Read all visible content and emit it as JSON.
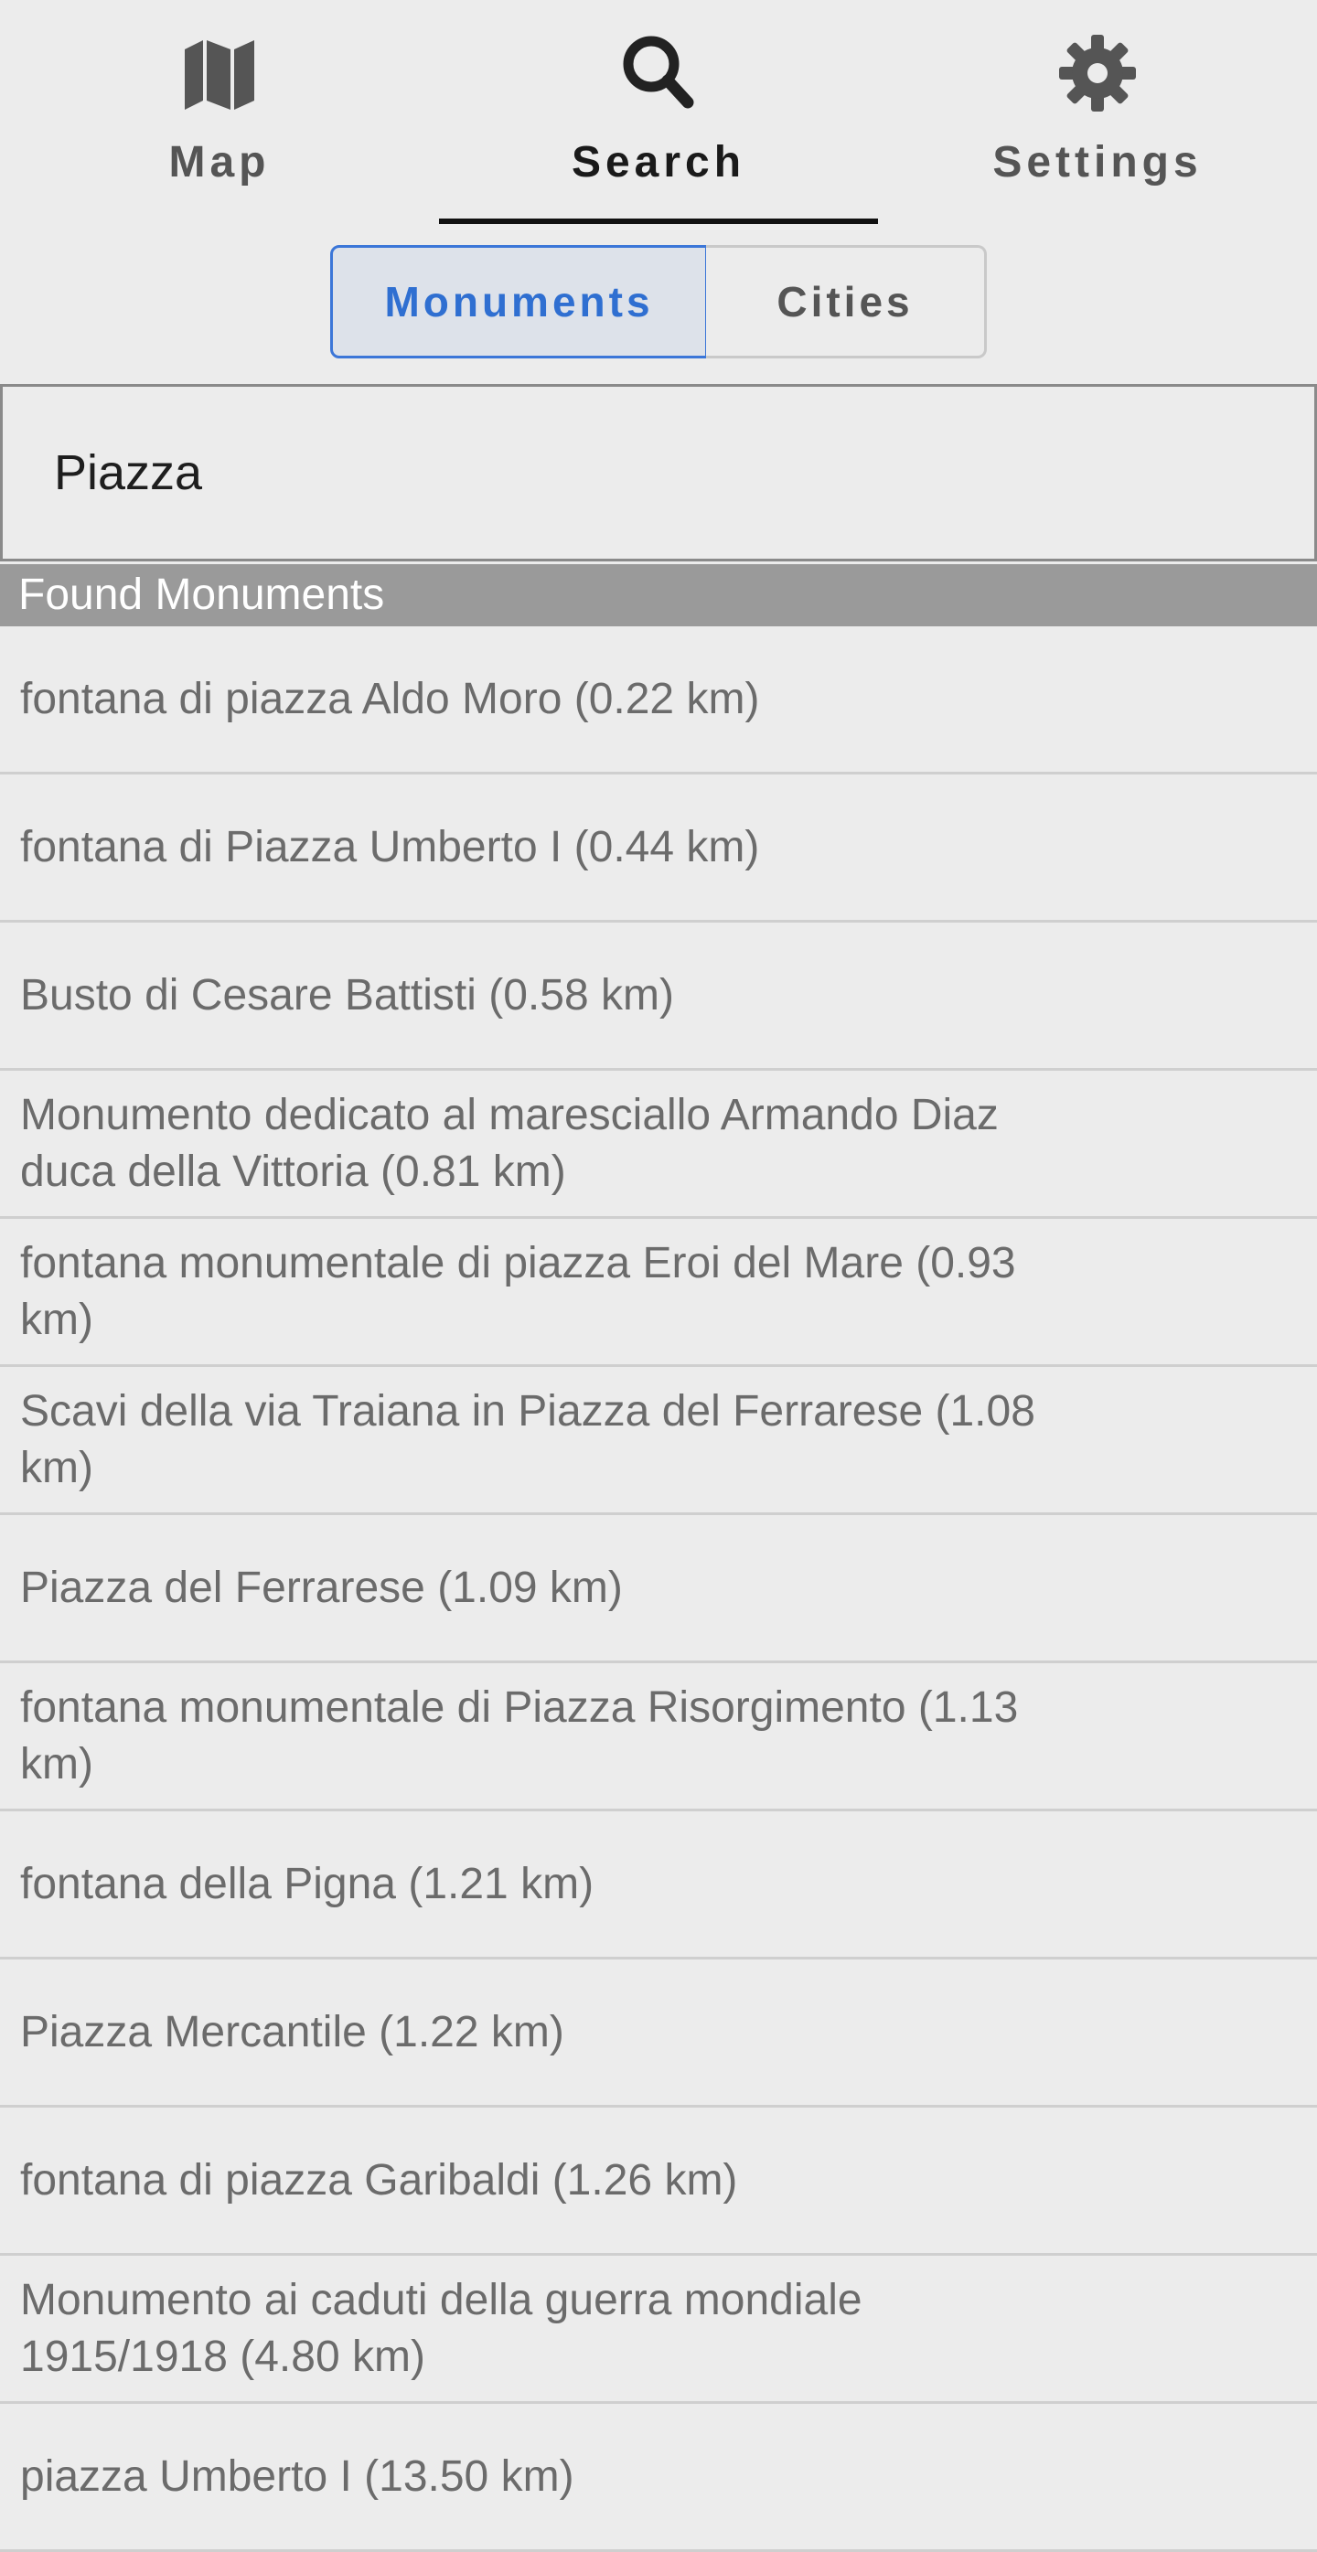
{
  "nav": {
    "tabs": [
      {
        "label": "Map",
        "icon": "map-icon"
      },
      {
        "label": "Search",
        "icon": "search-icon"
      },
      {
        "label": "Settings",
        "icon": "gear-icon"
      }
    ],
    "active": "Search"
  },
  "segment": {
    "monuments": "Monuments",
    "cities": "Cities",
    "selected": "Monuments"
  },
  "search": {
    "value": "Piazza"
  },
  "section": {
    "title": "Found Monuments"
  },
  "results": [
    "fontana di piazza Aldo Moro (0.22 km)",
    "fontana di Piazza Umberto I (0.44 km)",
    "Busto di Cesare Battisti (0.58 km)",
    "Monumento dedicato al maresciallo Armando Diaz duca della Vittoria (0.81 km)",
    "fontana monumentale di piazza Eroi del Mare (0.93 km)",
    "Scavi della via Traiana in Piazza del Ferrarese (1.08 km)",
    "Piazza del Ferrarese (1.09 km)",
    "fontana monumentale di Piazza Risorgimento (1.13 km)",
    "fontana della Pigna (1.21 km)",
    "Piazza Mercantile (1.22 km)",
    "fontana di piazza Garibaldi (1.26 km)",
    "Monumento ai caduti della guerra mondiale 1915/1918 (4.80 km)",
    "piazza Umberto I (13.50 km)"
  ],
  "colors": {
    "accent": "#3b76d8",
    "background": "#ececec",
    "section_header": "#9a9a9a"
  }
}
